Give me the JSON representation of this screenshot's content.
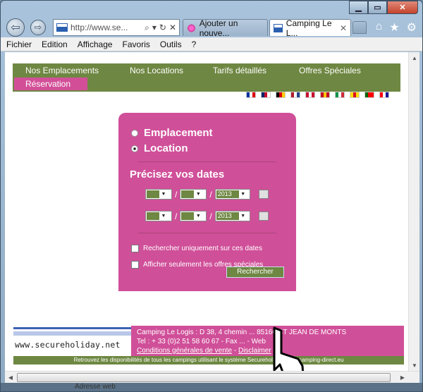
{
  "browser": {
    "address": "http://www.se...",
    "tabs": [
      {
        "label": "Ajouter un nouve..."
      },
      {
        "label": "Camping Le L..."
      }
    ],
    "menu": [
      "Fichier",
      "Edition",
      "Affichage",
      "Favoris",
      "Outils",
      "?"
    ]
  },
  "site": {
    "nav": [
      "Nos Emplacements",
      "Nos Locations",
      "Tarifs détaillés",
      "Offres Spéciales"
    ],
    "nav_active": "Réservation",
    "flags": [
      {
        "name": "fr-flag",
        "colors": [
          "#0032a0",
          "#ffffff",
          "#e1000f"
        ]
      },
      {
        "name": "uk-flag",
        "colors": [
          "#012169",
          "#c8102e",
          "#ffffff"
        ]
      },
      {
        "name": "de-flag",
        "colors": [
          "#000000",
          "#dd0000",
          "#ffce00"
        ]
      },
      {
        "name": "nl-flag",
        "colors": [
          "#ae1c28",
          "#ffffff",
          "#21468b"
        ]
      },
      {
        "name": "dk-flag",
        "colors": [
          "#c8102e",
          "#ffffff",
          "#c8102e"
        ]
      },
      {
        "name": "es-flag",
        "colors": [
          "#c60b1e",
          "#ffc400",
          "#c60b1e"
        ]
      },
      {
        "name": "it-flag",
        "colors": [
          "#009246",
          "#ffffff",
          "#ce2b37"
        ]
      },
      {
        "name": "cat-flag",
        "colors": [
          "#fcdd09",
          "#da121a",
          "#fcdd09"
        ]
      },
      {
        "name": "pt-flag",
        "colors": [
          "#006600",
          "#ff0000",
          "#ff0000"
        ]
      },
      {
        "name": "hr-flag",
        "colors": [
          "#ff0000",
          "#ffffff",
          "#171796"
        ]
      }
    ]
  },
  "form": {
    "option_emplacement": "Emplacement",
    "option_location": "Location",
    "dates_title": "Précisez vos dates",
    "year1": "2013",
    "year2": "2013",
    "check_dates": "Rechercher uniquement sur ces dates",
    "check_offers": "Afficher seulement les offres spéciales",
    "search_btn": "Rechercher"
  },
  "footer": {
    "logo_text": "www.secureholiday.net",
    "address": "Camping Le Logis : D 38, 4 chemin ... 85160 ST JEAN DE MONTS",
    "tel": "Tel : + 33 (0)2 51 58 60 67 - Fax ... - Web",
    "conditions": "Conditions générales de vente",
    "disclaimer": "Disclaimer",
    "bottom": "Retrouvez les disponibilités de tous les campings utilisant le système Secureholiday sur fr.camping-direct.eu"
  },
  "colors": {
    "pink": "#d04f99",
    "green": "#6e8742"
  },
  "taskbar_text": "Adresse web"
}
